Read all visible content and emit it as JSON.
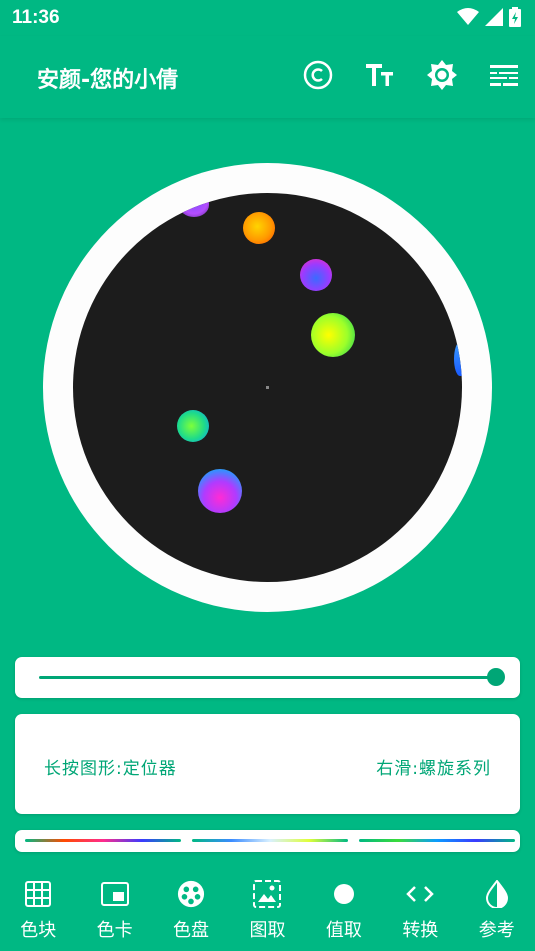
{
  "status": {
    "time": "11:36"
  },
  "app_bar": {
    "title": "安颜-您的小倩",
    "actions": [
      {
        "name": "copyright-icon"
      },
      {
        "name": "text-size-icon"
      },
      {
        "name": "brightness-icon"
      },
      {
        "name": "settings-sliders-icon"
      }
    ]
  },
  "slider": {
    "value_percent": 100
  },
  "info": {
    "left_hint": "长按图形:定位器",
    "right_hint": "右滑:螺旋系列"
  },
  "bottom_nav": {
    "items": [
      {
        "label": "色块",
        "icon": "grid-icon"
      },
      {
        "label": "色卡",
        "icon": "card-icon"
      },
      {
        "label": "色盘",
        "icon": "palette-icon"
      },
      {
        "label": "图取",
        "icon": "image-picker-icon"
      },
      {
        "label": "值取",
        "icon": "dot-icon"
      },
      {
        "label": "转换",
        "icon": "code-icon"
      },
      {
        "label": "参考",
        "icon": "contrast-icon"
      }
    ],
    "active_index": 2
  },
  "colors": {
    "primary": "#00B883",
    "accent": "#00A676",
    "wheel_bg": "#1C1C1C"
  }
}
